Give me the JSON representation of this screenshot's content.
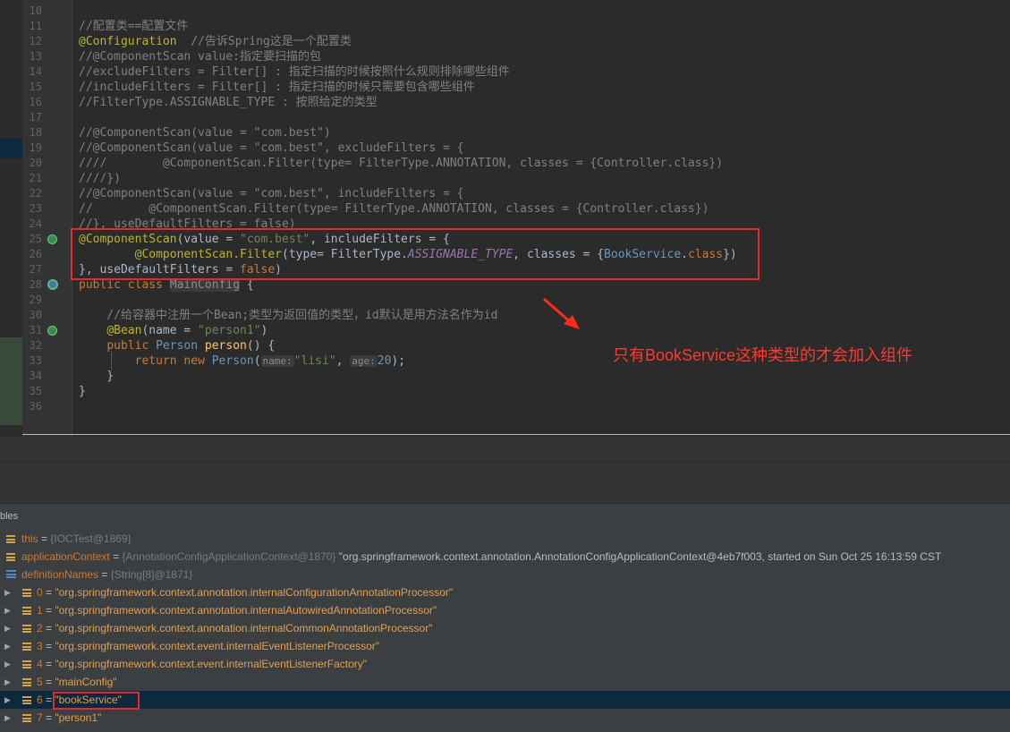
{
  "editor": {
    "line_numbers": [
      "10",
      "11",
      "12",
      "13",
      "14",
      "15",
      "16",
      "17",
      "18",
      "19",
      "20",
      "21",
      "22",
      "23",
      "24",
      "25",
      "26",
      "27",
      "28",
      "29",
      "30",
      "31",
      "32",
      "33",
      "34",
      "35",
      "36"
    ],
    "lines": {
      "l11": "//配置类==配置文件",
      "l12_annot": "@Configuration",
      "l12_comment": "  //告诉Spring这是一个配置类",
      "l13": "//@ComponentScan value:指定要扫描的包",
      "l14": "//excludeFilters = Filter[] : 指定扫描的时候按照什么规则排除哪些组件",
      "l15": "//includeFilters = Filter[] : 指定扫描的时候只需要包含哪些组件",
      "l16": "//FilterType.ASSIGNABLE_TYPE : 按照给定的类型",
      "l18": "//@ComponentScan(value = \"com.best\")",
      "l19": "//@ComponentScan(value = \"com.best\", excludeFilters = {",
      "l20": "////        @ComponentScan.Filter(type= FilterType.ANNOTATION, classes = {Controller.class})",
      "l21": "////})",
      "l22": "//@ComponentScan(value = \"com.best\", includeFilters = {",
      "l23": "//        @ComponentScan.Filter(type= FilterType.ANNOTATION, classes = {Controller.class})",
      "l24": "//}, useDefaultFilters = false)",
      "l25_a": "@ComponentScan",
      "l25_b": "(value = ",
      "l25_c": "\"com.best\"",
      "l25_d": ", includeFilters = {",
      "l26_indent": "        ",
      "l26_a": "@ComponentScan.Filter",
      "l26_b": "(type= FilterType.",
      "l26_c": "ASSIGNABLE_TYPE",
      "l26_d": ", classes = {",
      "l26_e": "BookService",
      "l26_f": ".",
      "l26_g": "class",
      "l26_h": "})",
      "l27_a": "}, useDefaultFilters = ",
      "l27_b": "false",
      "l27_c": ")",
      "l28_a": "public class ",
      "l28_b": "MainConfig",
      "l28_c": " {",
      "l30": "    //给容器中注册一个Bean;类型为返回值的类型，id默认是用方法名作为id",
      "l31_indent": "    ",
      "l31_a": "@Bean",
      "l31_b": "(name = ",
      "l31_c": "\"person1\"",
      "l31_d": ")",
      "l32_indent": "    ",
      "l32_a": "public ",
      "l32_b": "Person ",
      "l32_c": "person",
      "l32_d": "() {",
      "l33_indent": "        ",
      "l33_a": "return new ",
      "l33_b": "Person",
      "l33_c": "(",
      "l33_hint1": "name:",
      "l33_d": "\"lisi\"",
      "l33_e": ", ",
      "l33_hint2": "age:",
      "l33_f": "20",
      "l33_g": ");",
      "l34": "    }",
      "l35": "}"
    },
    "annotation_text": "只有BookService这种类型的才会加入组件"
  },
  "variables_panel": {
    "title": "bles",
    "rows": [
      {
        "name": "this",
        "eq": " = ",
        "ref": "{IOCTest@1869}",
        "value": ""
      },
      {
        "name": "applicationContext",
        "eq": " = ",
        "ref": "{AnnotationConfigApplicationContext@1870}",
        "value": " \"org.springframework.context.annotation.AnnotationConfigApplicationContext@4eb7f003, started on Sun Oct 25 16:13:59 CST"
      },
      {
        "name": "definitionNames",
        "eq": " = ",
        "ref": "{String[8]@1871}",
        "value": ""
      },
      {
        "name": "0",
        "eq": " = ",
        "value": "\"org.springframework.context.annotation.internalConfigurationAnnotationProcessor\""
      },
      {
        "name": "1",
        "eq": " = ",
        "value": "\"org.springframework.context.annotation.internalAutowiredAnnotationProcessor\""
      },
      {
        "name": "2",
        "eq": " = ",
        "value": "\"org.springframework.context.annotation.internalCommonAnnotationProcessor\""
      },
      {
        "name": "3",
        "eq": " = ",
        "value": "\"org.springframework.context.event.internalEventListenerProcessor\""
      },
      {
        "name": "4",
        "eq": " = ",
        "value": "\"org.springframework.context.event.internalEventListenerFactory\""
      },
      {
        "name": "5",
        "eq": " = ",
        "value": "\"mainConfig\""
      },
      {
        "name": "6",
        "eq": " = ",
        "value": "\"bookService\""
      },
      {
        "name": "7",
        "eq": " = ",
        "value": "\"person1\""
      }
    ]
  },
  "colors": {
    "highlight_box": "#e8262b",
    "annotation": "#ff3a2a",
    "selected_row": "#0d293e"
  }
}
